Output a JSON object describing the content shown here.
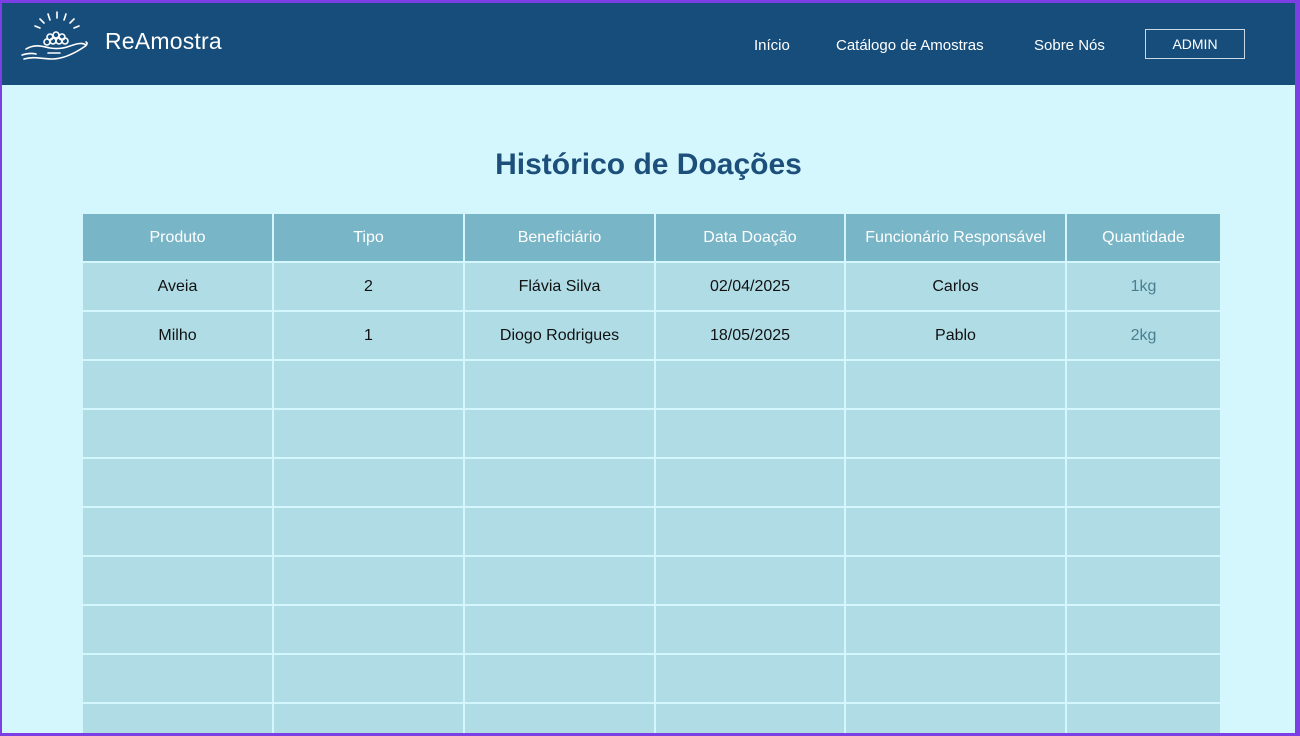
{
  "app": {
    "name": "ReAmostra"
  },
  "nav": {
    "links": [
      "Início",
      "Catálogo de Amostras",
      "Sobre Nós"
    ],
    "admin_label": "ADMIN"
  },
  "page": {
    "title": "Histórico de Doações"
  },
  "table": {
    "headers": [
      "Produto",
      "Tipo",
      "Beneficiário",
      "Data Doação",
      "Funcionário Responsável",
      "Quantidade"
    ],
    "rows": [
      [
        "Aveia",
        "2",
        "Flávia Silva",
        "02/04/2025",
        "Carlos",
        "1kg"
      ],
      [
        "Milho",
        "1",
        "Diogo Rodrigues",
        "18/05/2025",
        "Pablo",
        "2kg"
      ],
      [
        "",
        "",
        "",
        "",
        "",
        ""
      ],
      [
        "",
        "",
        "",
        "",
        "",
        ""
      ],
      [
        "",
        "",
        "",
        "",
        "",
        ""
      ],
      [
        "",
        "",
        "",
        "",
        "",
        ""
      ],
      [
        "",
        "",
        "",
        "",
        "",
        ""
      ],
      [
        "",
        "",
        "",
        "",
        "",
        ""
      ],
      [
        "",
        "",
        "",
        "",
        "",
        ""
      ],
      [
        "",
        "",
        "",
        "",
        "",
        ""
      ]
    ]
  },
  "colors": {
    "navbar": "#174d7b",
    "background": "#d4f6fd",
    "header_cell": "#78b5c6",
    "body_cell": "#b0dce6",
    "title": "#1c4f7a"
  },
  "icons": {
    "logo": "hand-holding-seeds-icon"
  }
}
